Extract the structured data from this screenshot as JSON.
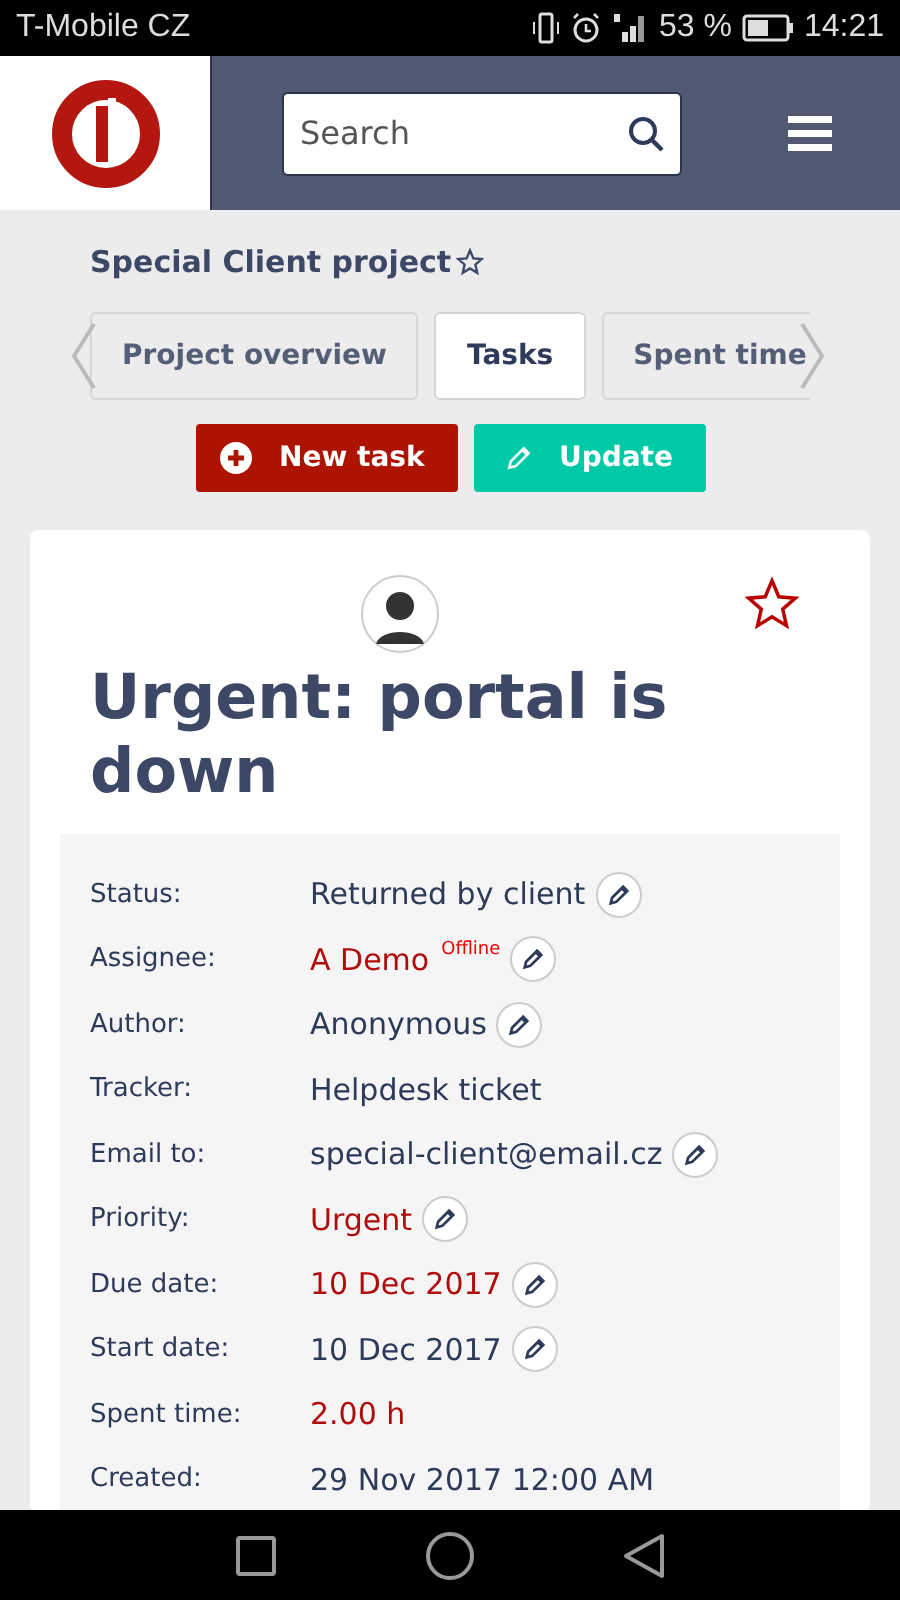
{
  "status_bar": {
    "carrier": "T-Mobile CZ",
    "battery": "53 %",
    "time": "14:21"
  },
  "header": {
    "search": {
      "placeholder": "Search"
    }
  },
  "project": {
    "title": "Special Client project",
    "starred": false
  },
  "tabs": [
    {
      "label": "Project overview",
      "selected": false
    },
    {
      "label": "Tasks",
      "selected": true
    },
    {
      "label": "Spent time",
      "selected": false
    }
  ],
  "actions": [
    {
      "label": "New task",
      "kind": "new"
    },
    {
      "label": "Update",
      "kind": "edit"
    }
  ],
  "task": {
    "title": "Urgent: portal is down",
    "starred": false,
    "fields": [
      {
        "label": "Status:",
        "value": "Returned by client",
        "highlight": false,
        "editable": true
      },
      {
        "label": "Assignee:",
        "value": "A Demo",
        "badge": "Offline",
        "highlight": true,
        "editable": true
      },
      {
        "label": "Author:",
        "value": "Anonymous",
        "highlight": false,
        "editable": true
      },
      {
        "label": "Tracker:",
        "value": "Helpdesk ticket",
        "highlight": false,
        "editable": false
      },
      {
        "label": "Email to:",
        "value": "special-client@email.cz",
        "highlight": false,
        "editable": true
      },
      {
        "label": "Priority:",
        "value": "Urgent",
        "highlight": true,
        "editable": true
      },
      {
        "label": "Due date:",
        "value": "10 Dec 2017",
        "highlight": true,
        "editable": true
      },
      {
        "label": "Start date:",
        "value": "10 Dec 2017",
        "highlight": false,
        "editable": true
      },
      {
        "label": "Spent time:",
        "value": "2.00 h",
        "highlight": true,
        "editable": false
      },
      {
        "label": "Created:",
        "value": "29 Nov 2017 12:00 AM",
        "highlight": false,
        "editable": false
      }
    ]
  }
}
